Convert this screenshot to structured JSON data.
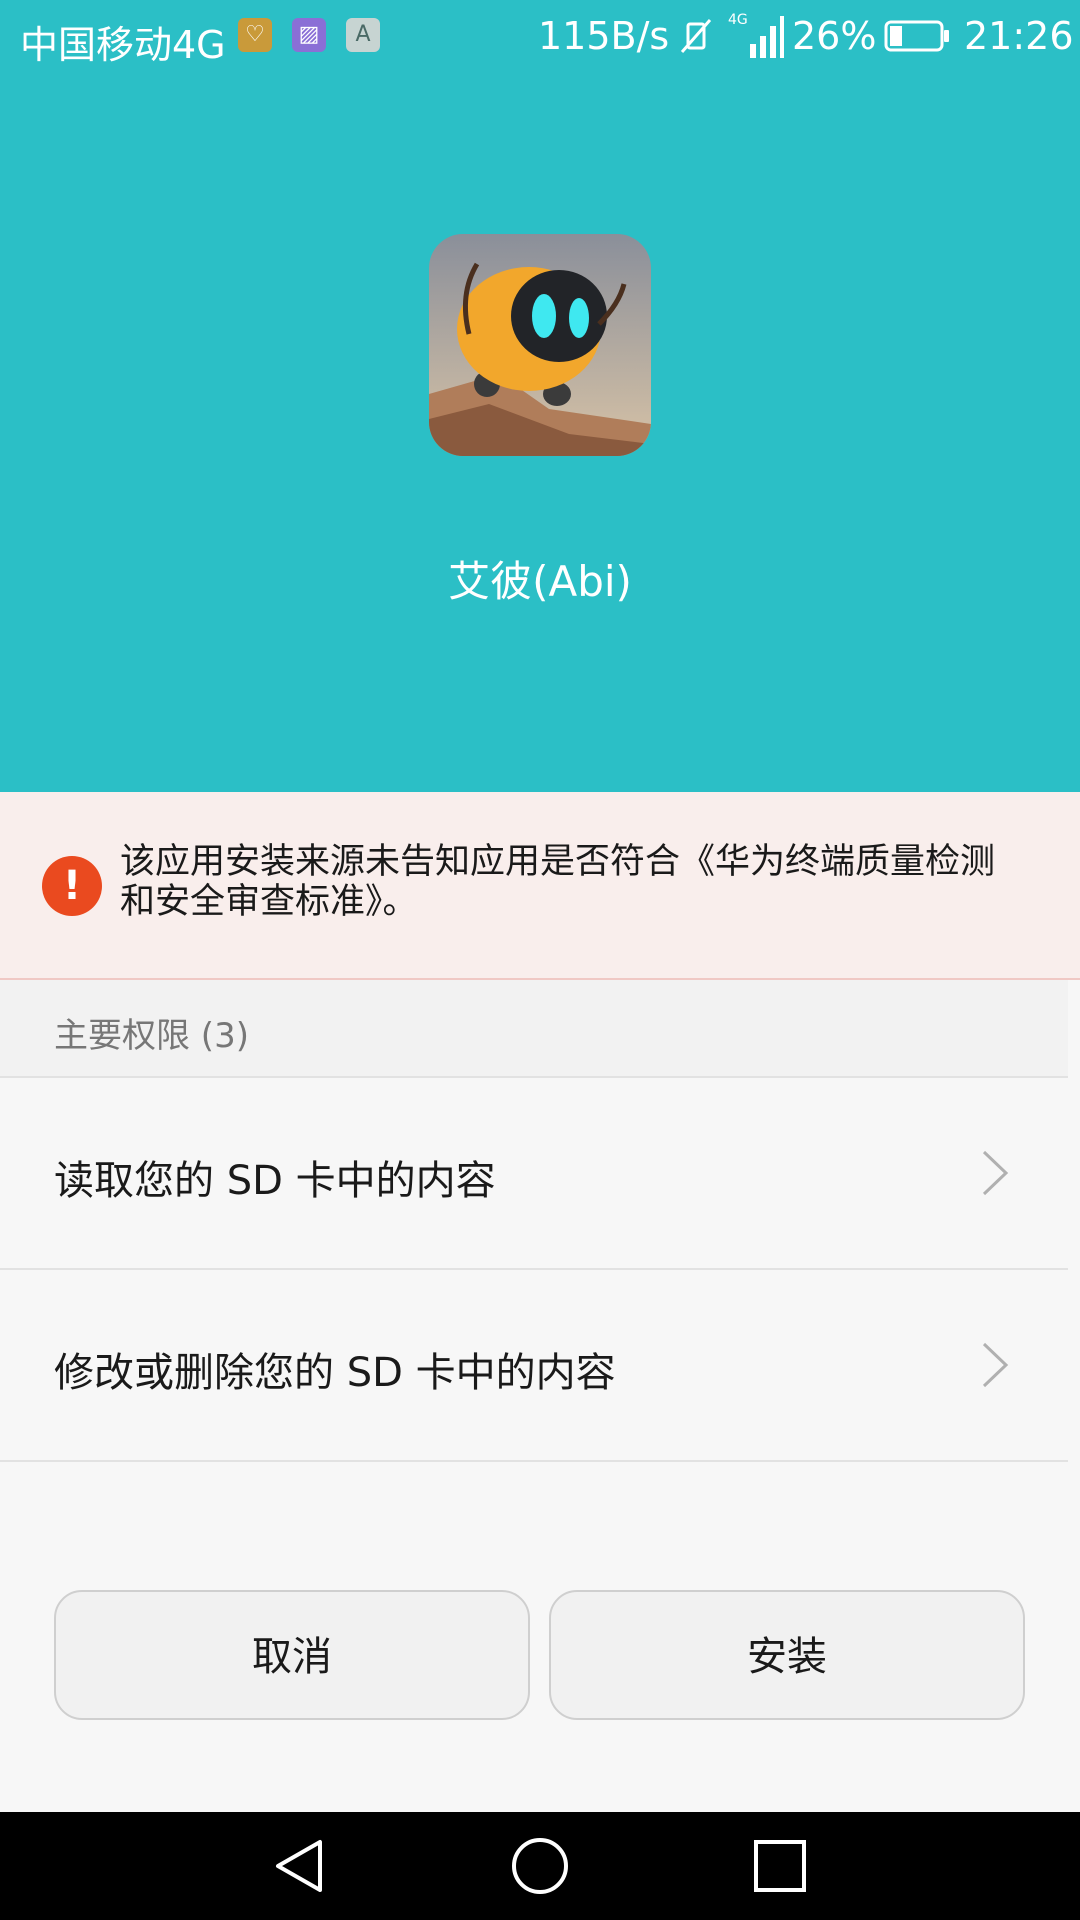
{
  "status_bar": {
    "carrier": "中国移动4G",
    "notif_icons": [
      {
        "name": "health-app-icon",
        "color": "#c99a3a",
        "glyph": "♡"
      },
      {
        "name": "gallery-app-icon",
        "color": "#8a6fd6",
        "glyph": "▨"
      },
      {
        "name": "font-app-icon",
        "color": "#c7d4d2",
        "glyph": "A"
      }
    ],
    "net_speed": "115B/s",
    "network_type": "4G",
    "battery_percent": "26%",
    "battery_level": 0.26,
    "time": "21:26"
  },
  "app": {
    "name": "艾彼(Abi)",
    "icon": "robot-app-icon"
  },
  "warning": {
    "icon": "exclamation-icon",
    "text": "该应用安装来源未告知应用是否符合《华为终端质量检测和安全审查标准》。"
  },
  "permissions": {
    "header": "主要权限 (3)",
    "items": [
      {
        "label": "读取您的 SD 卡中的内容"
      },
      {
        "label": "修改或删除您的 SD 卡中的内容"
      }
    ]
  },
  "buttons": {
    "cancel": "取消",
    "install": "安装"
  },
  "colors": {
    "header_bg": "#2bbfc6",
    "warning_bg": "#f9eeec",
    "warning_icon": "#ea4a1f"
  },
  "navbar": {
    "back_icon": "back-triangle-icon",
    "home_icon": "home-circle-icon",
    "recents_icon": "recents-square-icon"
  }
}
